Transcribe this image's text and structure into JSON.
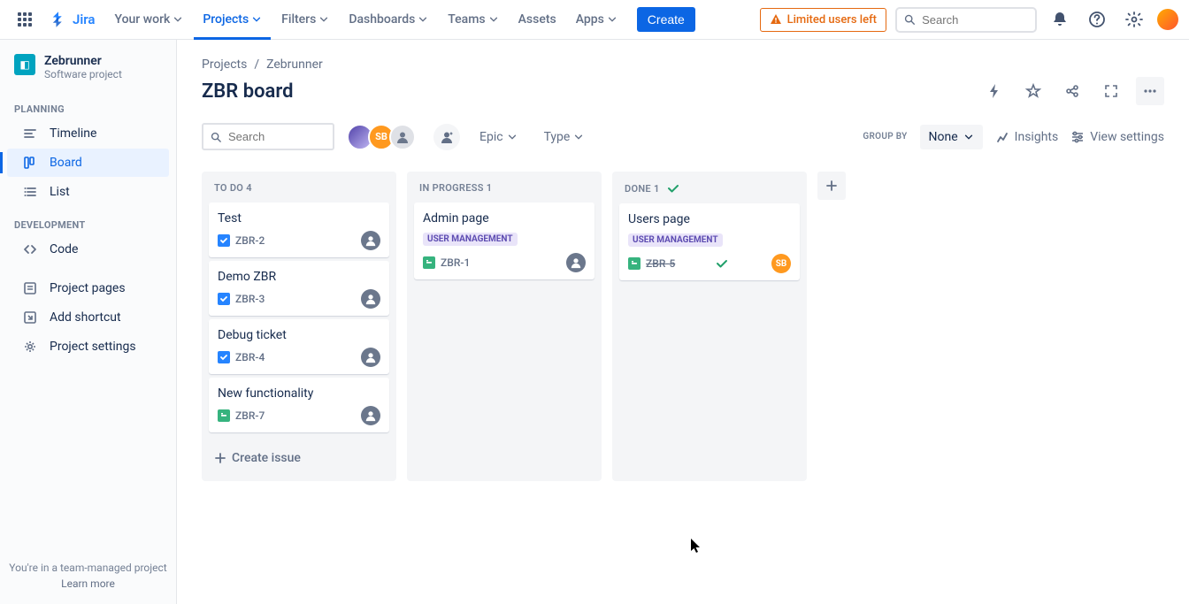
{
  "topnav": {
    "logo_text": "Jira",
    "items": [
      {
        "label": "Your work",
        "chev": true,
        "active": false
      },
      {
        "label": "Projects",
        "chev": true,
        "active": true
      },
      {
        "label": "Filters",
        "chev": true,
        "active": false
      },
      {
        "label": "Dashboards",
        "chev": true,
        "active": false
      },
      {
        "label": "Teams",
        "chev": true,
        "active": false
      },
      {
        "label": "Assets",
        "chev": false,
        "active": false
      },
      {
        "label": "Apps",
        "chev": true,
        "active": false
      }
    ],
    "create": "Create",
    "limited": "Limited users left",
    "search_placeholder": "Search"
  },
  "sidebar": {
    "project_name": "Zebrunner",
    "project_type": "Software project",
    "sections": {
      "planning_label": "PLANNING",
      "dev_label": "DEVELOPMENT"
    },
    "planning": [
      {
        "id": "timeline",
        "label": "Timeline"
      },
      {
        "id": "board",
        "label": "Board"
      },
      {
        "id": "list",
        "label": "List"
      }
    ],
    "dev": [
      {
        "id": "code",
        "label": "Code"
      }
    ],
    "extra": [
      {
        "id": "project-pages",
        "label": "Project pages"
      },
      {
        "id": "add-shortcut",
        "label": "Add shortcut"
      },
      {
        "id": "project-settings",
        "label": "Project settings"
      }
    ],
    "footer1": "You're in a team-managed project",
    "footer2": "Learn more"
  },
  "content": {
    "breadcrumb": [
      "Projects",
      "Zebrunner"
    ],
    "title": "ZBR board",
    "toolbar": {
      "search_placeholder": "Search",
      "filters": [
        {
          "label": "Epic"
        },
        {
          "label": "Type"
        }
      ],
      "groupby_label": "GROUP BY",
      "groupby_value": "None",
      "insights": "Insights",
      "view_settings": "View settings"
    },
    "avatars": [
      {
        "kind": "img"
      },
      {
        "kind": "initials",
        "text": "SB"
      },
      {
        "kind": "unassigned"
      }
    ]
  },
  "board": {
    "columns": [
      {
        "name": "TO DO",
        "count": 4,
        "done": false,
        "cards": [
          {
            "title": "Test",
            "type": "task",
            "key": "ZBR-2",
            "epic": null,
            "struck": false,
            "assignee": "unassigned"
          },
          {
            "title": "Demo ZBR",
            "type": "task",
            "key": "ZBR-3",
            "epic": null,
            "struck": false,
            "assignee": "unassigned"
          },
          {
            "title": "Debug ticket",
            "type": "task",
            "key": "ZBR-4",
            "epic": null,
            "struck": false,
            "assignee": "unassigned"
          },
          {
            "title": "New functionality",
            "type": "story",
            "key": "ZBR-7",
            "epic": null,
            "struck": false,
            "assignee": "unassigned"
          }
        ],
        "create": "Create issue"
      },
      {
        "name": "IN PROGRESS",
        "count": 1,
        "done": false,
        "cards": [
          {
            "title": "Admin page",
            "type": "story",
            "key": "ZBR-1",
            "epic": "USER MANAGEMENT",
            "struck": false,
            "assignee": "unassigned"
          }
        ]
      },
      {
        "name": "DONE",
        "count": 1,
        "done": true,
        "cards": [
          {
            "title": "Users page",
            "type": "story",
            "key": "ZBR-5",
            "epic": "USER MANAGEMENT",
            "struck": true,
            "assignee": "SB",
            "show_tick": true
          }
        ]
      }
    ]
  }
}
